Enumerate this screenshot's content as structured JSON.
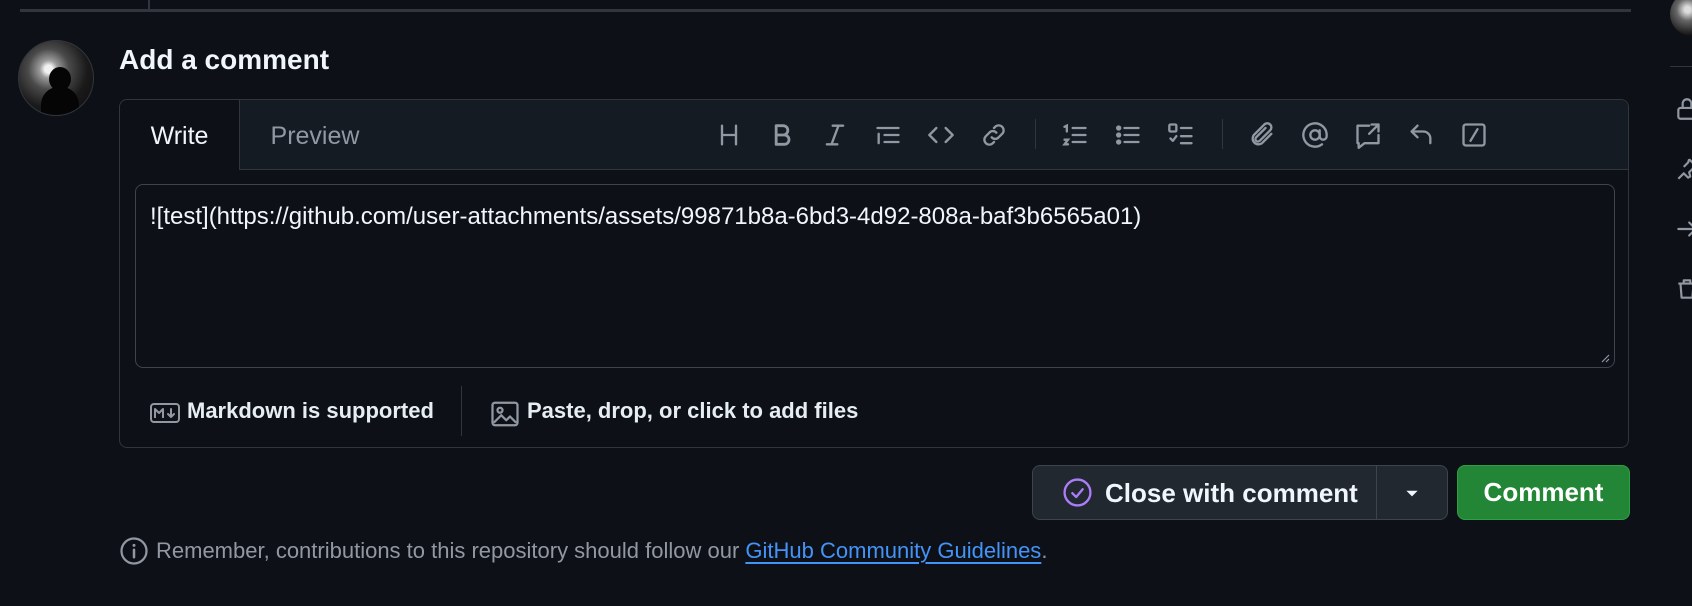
{
  "comment_box": {
    "heading": "Add a comment",
    "tabs": {
      "write": "Write",
      "preview": "Preview",
      "active": "write"
    },
    "toolbar": [
      "heading-icon",
      "bold-icon",
      "italic-icon",
      "quote-icon",
      "code-icon",
      "link-icon",
      "ordered-list-icon",
      "unordered-list-icon",
      "task-list-icon",
      "attach-icon",
      "mention-icon",
      "reference-icon",
      "saved-replies-icon",
      "slash-commands-icon"
    ],
    "textarea_value": "![test](https://github.com/user-attachments/assets/99871b8a-6bd3-4d92-808a-baf3b6565a01)",
    "markdown_note": "Markdown is supported",
    "attach_text": "Paste, drop, or click to add files"
  },
  "actions": {
    "close_with_comment": "Close with comment",
    "comment": "Comment"
  },
  "guidelines": {
    "prefix": "Remember, contributions to this repository should follow our ",
    "link_text": "GitHub Community Guidelines",
    "suffix": "."
  },
  "colors": {
    "background": "#0d1117",
    "primary_button": "#238636",
    "close_icon": "#ab7df8",
    "link": "#4493f8"
  }
}
